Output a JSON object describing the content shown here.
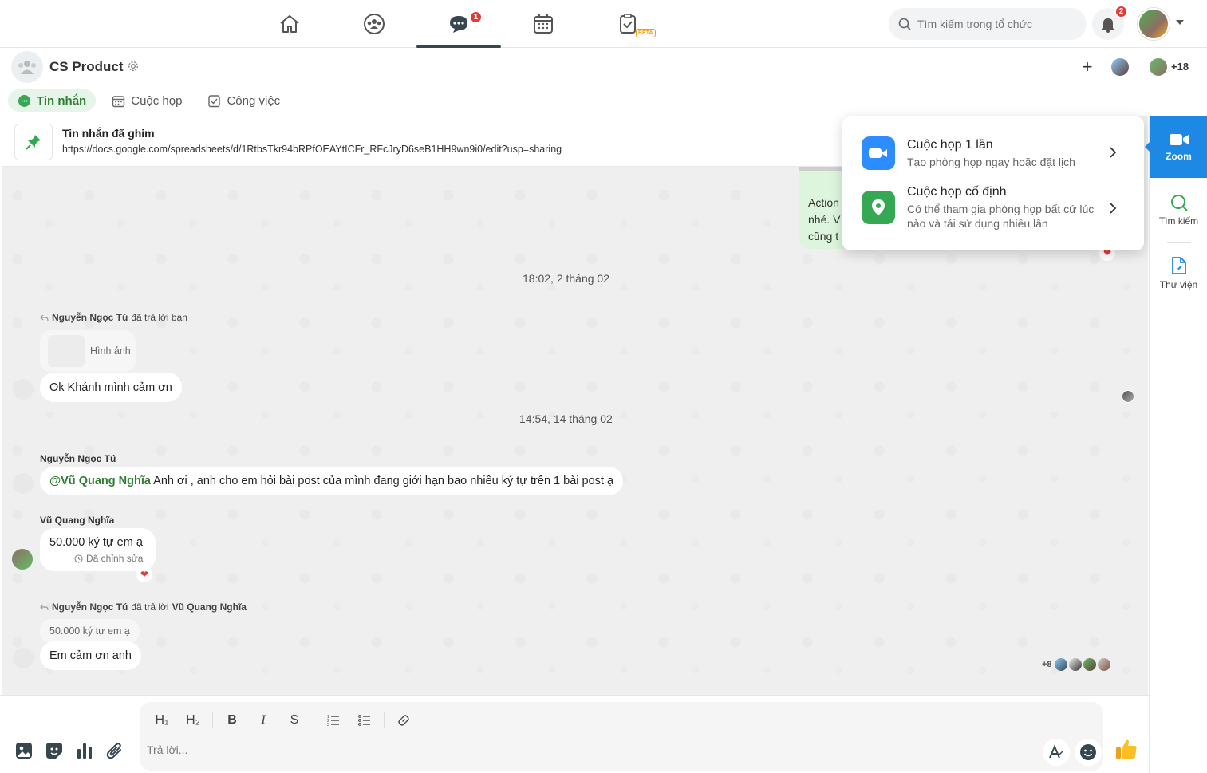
{
  "topnav": {
    "chat_badge": "1",
    "tasks_beta": "BETA"
  },
  "search": {
    "placeholder": "Tìm kiếm trong tổ chức"
  },
  "notifications": {
    "badge": "2"
  },
  "conversation": {
    "name": "CS Product",
    "extra_members": "+18"
  },
  "tabs": [
    {
      "label": "Tin nhắn",
      "icon": "chat-icon"
    },
    {
      "label": "Cuộc họp",
      "icon": "calendar-icon"
    },
    {
      "label": "Công việc",
      "icon": "checklist-icon"
    }
  ],
  "pinned": {
    "title": "Tin nhắn đã ghim",
    "link": "https://docs.google.com/spreadsheets/d/1RtbsTkr94bRPfOEAYtICFr_RFcJryD6seB1HH9wn9i0/edit?usp=sharing"
  },
  "stub_message": [
    "Action",
    "nhé. V",
    "cũng t"
  ],
  "messages": {
    "date1": "18:02, 2 tháng 02",
    "reply1": {
      "name": "Nguyễn Ngọc Tú",
      "action": "đã trả lời bạn",
      "quote": "Hình ảnh",
      "text": "Ok Khánh mình cảm ơn"
    },
    "date2": "14:54, 14 tháng 02",
    "msg2": {
      "sender": "Nguyễn Ngọc Tú",
      "mention": "@Vũ Quang Nghĩa",
      "text": " Anh ơi , anh cho em hỏi bài post của mình đang giới hạn bao nhiêu ký tự trên 1 bài post ạ"
    },
    "msg3": {
      "sender": "Vũ Quang Nghĩa",
      "text": "50.000 ký tự em ạ",
      "edited": "Đã chỉnh sửa"
    },
    "reply2": {
      "name": "Nguyễn Ngọc Tú",
      "action": "đã trả lời",
      "target": "Vũ Quang Nghĩa",
      "quote": "50.000 ký tự em ạ",
      "text": "Em cảm ơn anh"
    },
    "seen_more": "+8"
  },
  "zoom_popup": {
    "once_title": "Cuộc họp 1 lần",
    "once_desc": "Tạo phòng họp ngay hoặc đặt lịch",
    "fixed_title": "Cuộc họp cố định",
    "fixed_desc": "Có thể tham gia phòng họp bất cứ lúc nào và tái sử dụng nhiều lần"
  },
  "sidebar": {
    "zoom": "Zoom",
    "search": "Tìm kiếm",
    "library": "Thư viện"
  },
  "composer": {
    "placeholder": "Trả lời...",
    "h1": "H₁",
    "h2": "H₂"
  },
  "colors": {
    "accent_green": "#2e7d32",
    "zoom_blue": "#1e88e5",
    "badge_red": "#e53935"
  }
}
